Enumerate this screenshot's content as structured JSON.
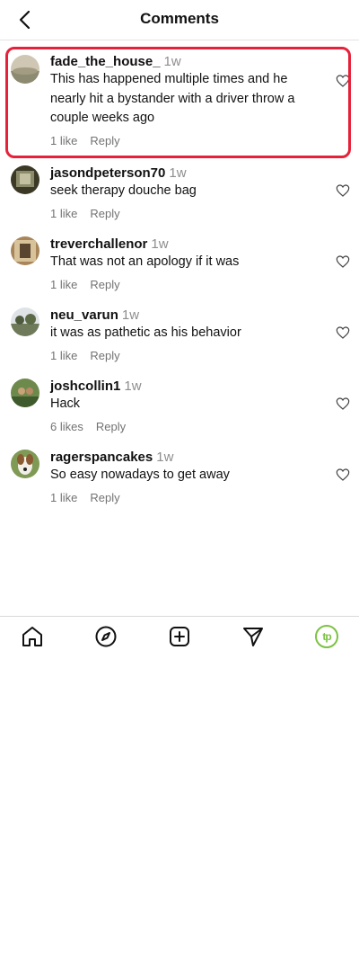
{
  "header": {
    "title": "Comments",
    "back_icon": "chevron-left-icon"
  },
  "comments": [
    {
      "username": "fade_the_house_",
      "time": "1w",
      "text": "This has happened multiple times and he nearly hit a bystander with a driver throw a couple weeks ago",
      "likes": "1 like",
      "reply": "Reply"
    },
    {
      "username": "jasondpeterson70",
      "time": "1w",
      "text": "seek therapy douche bag",
      "likes": "1 like",
      "reply": "Reply"
    },
    {
      "username": "treverchallenor",
      "time": "1w",
      "text": "That was not an apology if it was",
      "likes": "1 like",
      "reply": "Reply"
    },
    {
      "username": "neu_varun",
      "time": "1w",
      "text": "it was as pathetic as his behavior",
      "likes": "1 like",
      "reply": "Reply"
    },
    {
      "username": "joshcollin1",
      "time": "1w",
      "text": "Hack",
      "likes": "6 likes",
      "reply": "Reply"
    },
    {
      "username": "ragerspancakes",
      "time": "1w",
      "text": "So easy nowadays to get away",
      "likes": "1 like",
      "reply": "Reply"
    }
  ],
  "tabbar": {
    "items": [
      "home-icon",
      "explore-icon",
      "create-icon",
      "direct-icon",
      "profile-icon"
    ],
    "profile_badge": "tp",
    "accent": "#7cc242"
  },
  "highlight_color": "#e6213a"
}
